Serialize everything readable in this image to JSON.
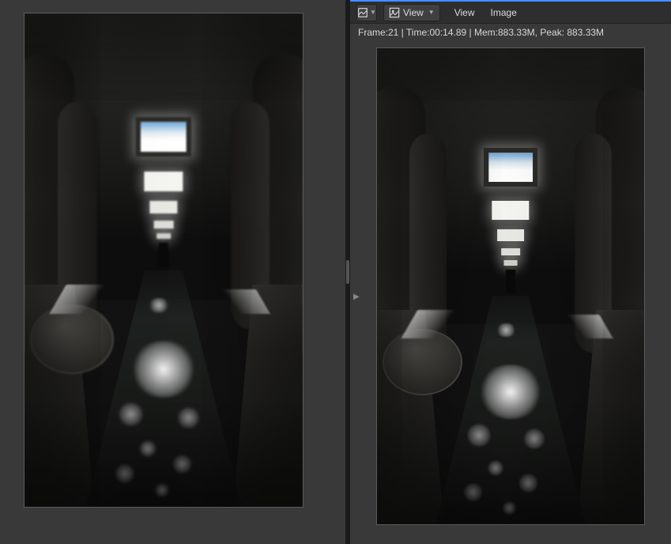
{
  "toolbar": {
    "image_settings_icon": "image-settings-icon",
    "display_channels_icon": "display-channels-icon",
    "view_dropdown_label": "View",
    "menu_view": "View",
    "menu_image": "Image"
  },
  "status": {
    "line": "Frame:21 | Time:00:14.89 | Mem:883.33M, Peak: 883.33M"
  }
}
